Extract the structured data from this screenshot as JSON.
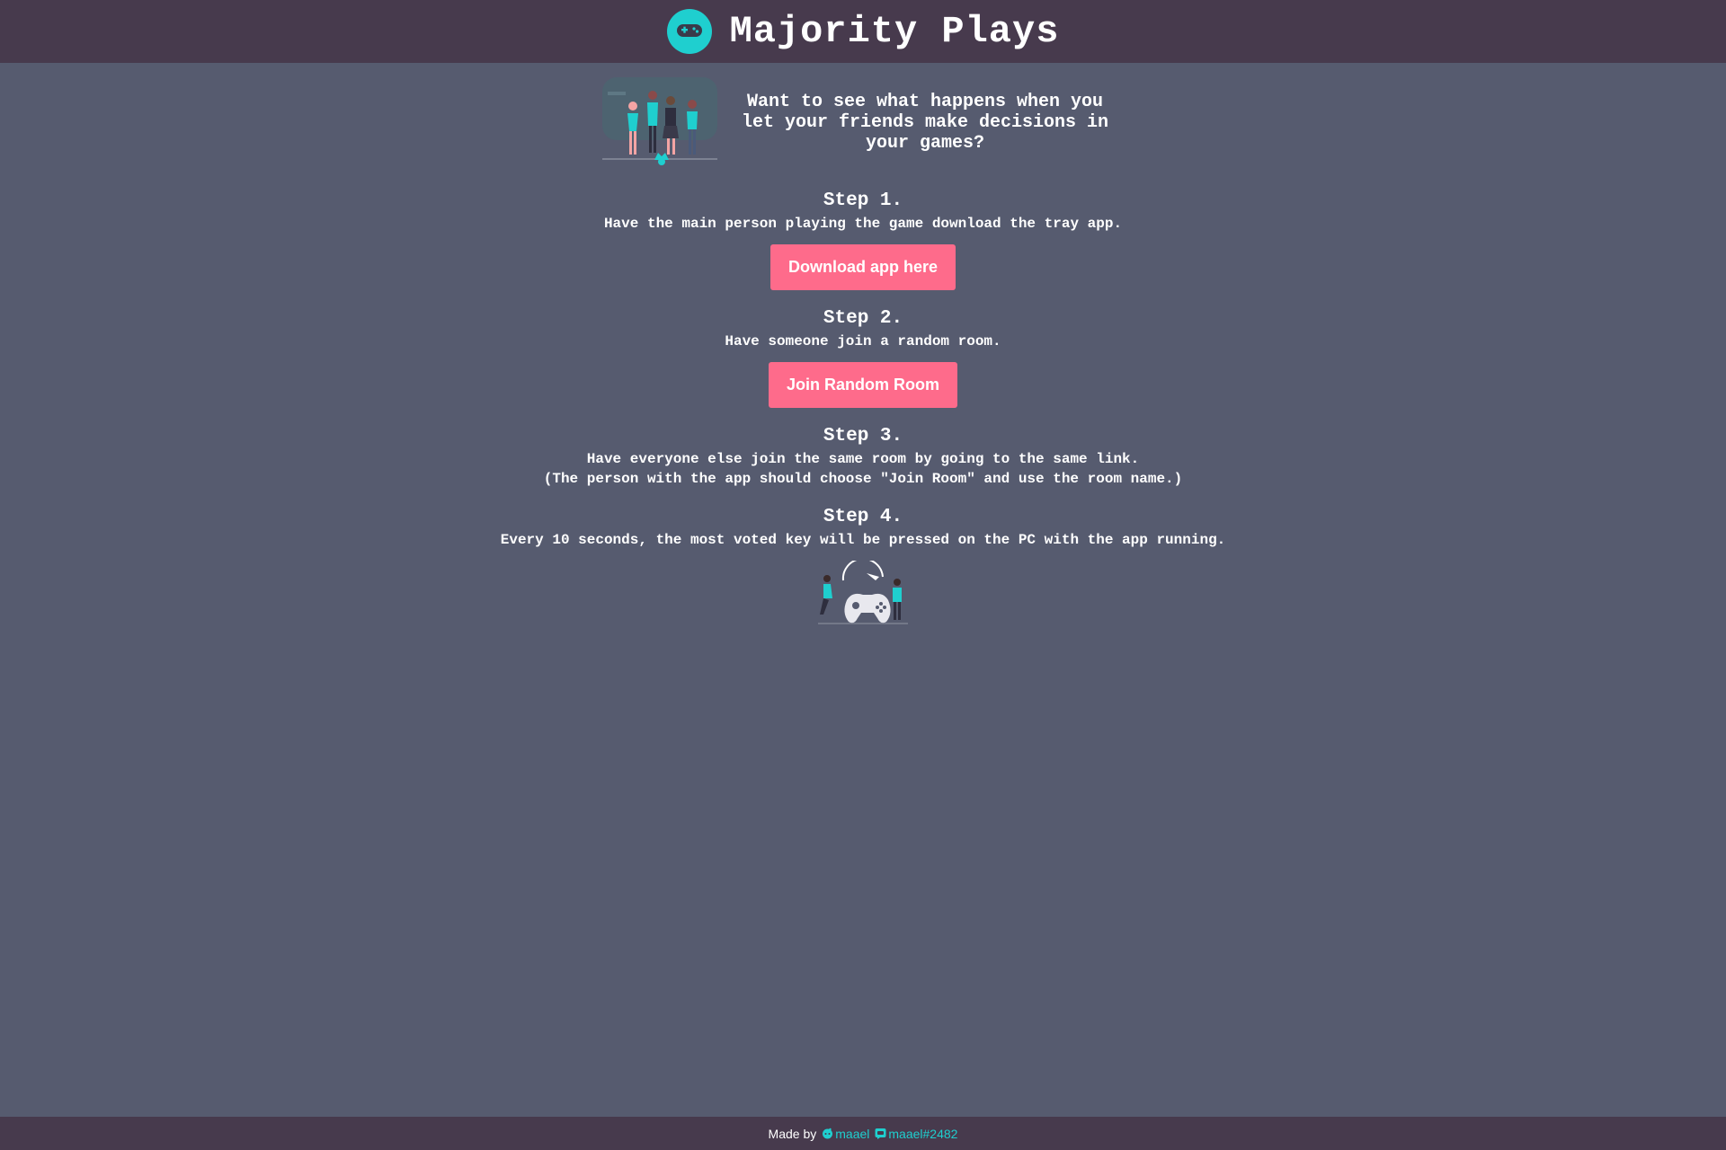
{
  "header": {
    "logo_icon": "gamepad-icon",
    "title": "Majority Plays"
  },
  "intro": {
    "illustration": "friends-illustration",
    "text": "Want to see what happens when you let your friends make decisions in your games?"
  },
  "steps": [
    {
      "title": "Step 1.",
      "text": "Have the main person playing the game download the tray app.",
      "button": "Download app here"
    },
    {
      "title": "Step 2.",
      "text": "Have someone join a random room.",
      "button": "Join Random Room"
    },
    {
      "title": "Step 3.",
      "text": "Have everyone else join the same room by going to the same link.",
      "note": "(The person with the app should choose \"Join Room\" and use the room name.)"
    },
    {
      "title": "Step 4.",
      "text": "Every 10 seconds, the most voted key will be pressed on the PC with the app running."
    }
  ],
  "bottom_illustration": "gamers-illustration",
  "footer": {
    "made_by": "Made by",
    "reddit_icon": "reddit-icon",
    "reddit_user": "maael",
    "discord_icon": "discord-icon",
    "discord_user": "maael#2482"
  },
  "colors": {
    "background": "#565b6f",
    "header": "#473a4d",
    "accent": "#1fcfcf",
    "button": "#fe6b8b"
  }
}
